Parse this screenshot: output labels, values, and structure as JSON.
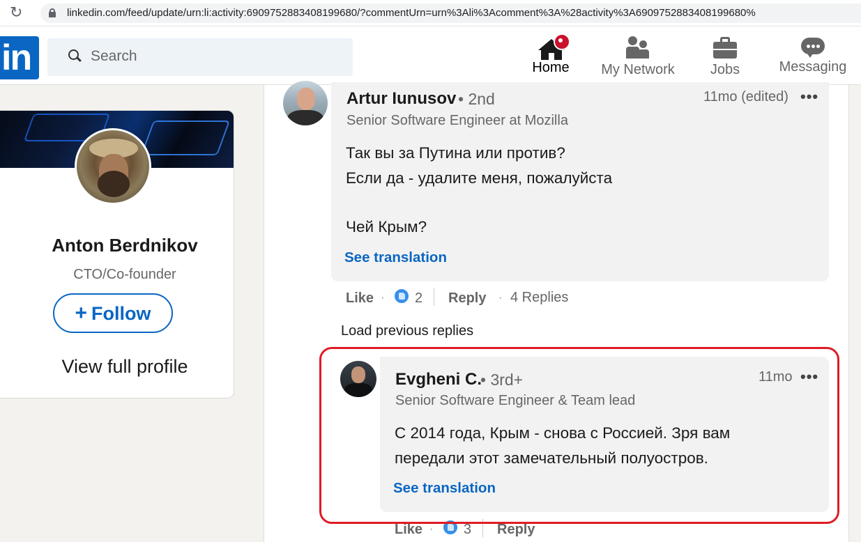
{
  "browser": {
    "url": "linkedin.com/feed/update/urn:li:activity:6909752883408199680/?commentUrn=urn%3Ali%3Acomment%3A%28activity%3A6909752883408199680%"
  },
  "nav": {
    "logo": "in",
    "search_placeholder": "Search",
    "items": [
      {
        "label": "Home",
        "icon": "home-icon",
        "active": true
      },
      {
        "label": "My Network",
        "icon": "people-icon"
      },
      {
        "label": "Jobs",
        "icon": "briefcase-icon"
      },
      {
        "label": "Messaging",
        "icon": "chat-bubble-icon"
      }
    ],
    "accent": "#0a66c2",
    "notification_color": "#cb112d"
  },
  "profile": {
    "name": "Anton Berdnikov",
    "title": "CTO/Co-founder",
    "follow_plus": "+",
    "follow_label": "Follow",
    "view_profile": "View full profile"
  },
  "comments": [
    {
      "author": "Artur Iunusov",
      "degree": "• 2nd",
      "headline": "Senior Software Engineer at Mozilla",
      "time": "11mo (edited)",
      "more": "•••",
      "lines": [
        "Так вы за Путина или против?",
        "Если да - удалите меня, пожалуйста",
        "Чей Крым?"
      ],
      "see_translation": "See translation",
      "like_label": "Like",
      "reaction_count": "2",
      "reply_label": "Reply",
      "replies": "4 Replies"
    },
    {
      "author": "Evgheni C.",
      "degree": "• 3rd+",
      "headline": "Senior Software Engineer & Team lead",
      "time": "11mo",
      "more": "•••",
      "lines": [
        "С 2014 года, Крым - снова с Россией. Зря вам",
        "передали этот замечательный полуостров."
      ],
      "see_translation": "See translation",
      "like_label": "Like",
      "reaction_count": "3",
      "reply_label": "Reply"
    }
  ],
  "load_previous": "Load previous replies",
  "highlight_color": "#e01b24"
}
